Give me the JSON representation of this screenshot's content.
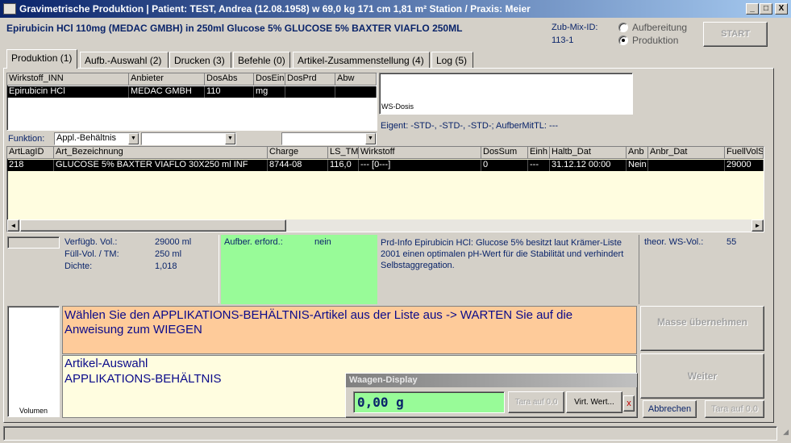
{
  "window": {
    "title": "Gravimetrische Produktion  |  Patient: TEST, Andrea (12.08.1958) w 69,0 kg  171 cm  1,81 m² Station / Praxis: Meier",
    "btn_min": "_",
    "btn_max": "□",
    "btn_close": "X"
  },
  "header": {
    "product": "Epirubicin HCl 110mg (MEDAC GMBH) in 250ml Glucose 5% GLUCOSE 5% BAXTER VIAFLO 250ML",
    "zub_label": "Zub-Mix-ID:",
    "zub_value": "113-1",
    "radio_aufbereitung": "Aufbereitung",
    "radio_produktion": "Produktion",
    "selected_mode": "Produktion",
    "start_label": "START"
  },
  "tabs": [
    {
      "label": "Produktion (1)"
    },
    {
      "label": "Aufb.-Auswahl (2)"
    },
    {
      "label": "Drucken (3)"
    },
    {
      "label": "Befehle (0)"
    },
    {
      "label": "Artikel-Zusammenstellung (4)"
    },
    {
      "label": "Log (5)"
    }
  ],
  "wirkstoff_grid": {
    "headers": [
      "Wirkstoff_INN",
      "Anbieter",
      "DosAbs",
      "DosEin",
      "DosPrd",
      "Abw"
    ],
    "row": [
      "Epirubicin HCl",
      "MEDAC GMBH",
      "110",
      "mg",
      "",
      ""
    ]
  },
  "ws_dosis_label": "WS-Dosis",
  "eigent_text": "Eigent: -STD-, -STD-, -STD-; AufberMitTL: ---",
  "funktion": {
    "label": "Funktion:",
    "value1": "Appl.-Behältnis",
    "value2": "",
    "value3": ""
  },
  "article_grid": {
    "headers": [
      "ArtLagID",
      "Art_Bezeichnung",
      "Charge",
      "LS_TM",
      "Wirkstoff",
      "DosSum",
      "Einh",
      "Haltb_Dat",
      "Anb",
      "Anbr_Dat",
      "FuellVolS"
    ],
    "row": [
      "218",
      "GLUCOSE 5% BAXTER VIAFLO   30X250 ml INF",
      "8744-08",
      "116,0",
      "--- [0---]",
      "0",
      "---",
      "31.12.12 00:00",
      "Nein",
      "",
      "29000"
    ],
    "scroll_left": "◄",
    "scroll_right": "►"
  },
  "info": {
    "verfueg_label": "Verfügb. Vol.:",
    "verfueg_value": "29000 ml",
    "fuell_label": "Füll-Vol. / TM:",
    "fuell_value": "250 ml",
    "dichte_label": "Dichte:",
    "dichte_value": "1,018",
    "aufber_label": "Aufber. erford.:",
    "aufber_value": "nein",
    "prdinfo": "Prd-Info Epirubicin HCl: Glucose 5% besitzt laut Krämer-Liste 2001 einen optimalen pH-Wert für die Stabilität und verhindert Selbstaggregation.",
    "theor_label": "theor. WS-Vol.:",
    "theor_value": "55"
  },
  "instruction": "Wählen Sie den APPLIKATIONS-BEHÄLTNIS-Artikel aus der Liste aus -> WARTEN Sie auf die Anweisung zum WIEGEN",
  "selection_line1": "Artikel-Auswahl",
  "selection_line2": "APPLIKATIONS-BEHÄLTNIS",
  "volumen_label": "Volumen",
  "waagen": {
    "title": "Waagen-Display",
    "value": "0,00  g",
    "tara_label": "Tara auf 0.0",
    "virt_label": "Virt. Wert...",
    "close_label": "x"
  },
  "buttons": {
    "masse": "Masse übernehmen",
    "weiter": "Weiter",
    "abbrechen": "Abbrechen",
    "tara": "Tara auf 0.0"
  },
  "colors": {
    "title_start": "#0a246a",
    "highlight_row": "#000000",
    "instruction_bg": "#fecb9a",
    "yellow_bg": "#fffde0",
    "green_bg": "#98fb98",
    "blue_text": "#0a246a"
  }
}
